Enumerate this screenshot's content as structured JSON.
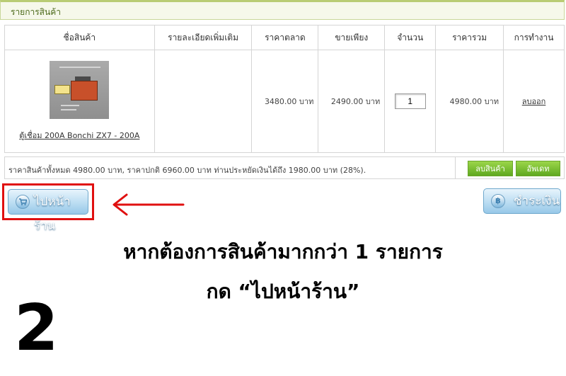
{
  "section_title": "รายการสินค้า",
  "columns": [
    "ชื่อสินค้า",
    "รายละเอียดเพิ่มเติม",
    "ราคาตลาด",
    "ขายเพียง",
    "จำนวน",
    "ราคารวม",
    "การทำงาน"
  ],
  "item": {
    "name": "ตู้เชื่อม 200A Bonchi ZX7 - 200A",
    "details": "",
    "market_price": "3480.00 บาท",
    "sale_price": "2490.00 บาท",
    "quantity": "1",
    "total": "4980.00 บาท",
    "action": "ลบออก"
  },
  "summary": {
    "text": "ราคาสินค้าทั้งหมด 4980.00 บาท,  ราคาปกติ 6960.00 บาท ท่านประหยัดเงินได้ถึง 1980.00 บาท (28%).",
    "remove_label": "ลบสินค้า",
    "update_label": "อัพเดท"
  },
  "buttons": {
    "shop_label": "ไปหน้าร้าน",
    "shop_icon": "cart-icon",
    "pay_label": "ชำระเงิน",
    "pay_icon": "baht-icon",
    "pay_icon_glyph": "฿"
  },
  "instruction": {
    "line1": "หากต้องการสินค้ามากกว่า 1 รายการ",
    "line2": "กด “ไปหน้าร้าน”",
    "step_number": "2"
  },
  "colors": {
    "header_green": "#4c6a1a",
    "button_green": "#7cc235",
    "button_blue": "#97c8e8",
    "highlight_red": "#e01010"
  }
}
